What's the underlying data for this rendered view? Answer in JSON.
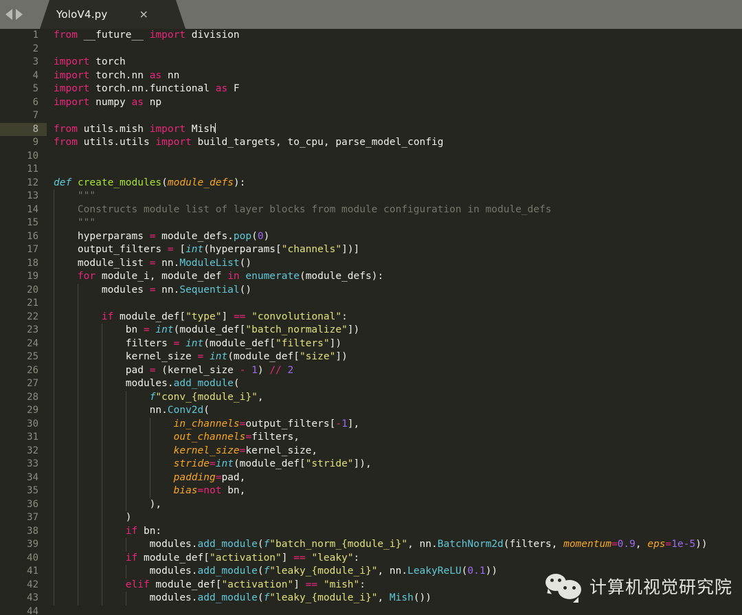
{
  "window": {
    "titlebar_color": "#6f6f69",
    "editor_background": "#262621",
    "nav_back_icon": "triangle-left",
    "nav_forward_icon": "triangle-right"
  },
  "tab": {
    "filename": "YoloV4.py",
    "close_label": "×",
    "active": true
  },
  "editor": {
    "language": "Python",
    "current_line": 8,
    "cursor_line": 8,
    "cursor_column": 30,
    "first_visible_line": 1,
    "last_visible_line": 44,
    "colors": {
      "keyword": "#e9267a",
      "definition": "#5fc9d8",
      "function_name": "#a6e22e",
      "parameter": "#f6a623",
      "string": "#e0e07a",
      "number": "#9d6cf0",
      "builtin": "#5fc9d8",
      "method": "#5fc9d8",
      "comment": "#76766c",
      "plain_text": "#f2f2ec",
      "gutter_text": "#8c8c82",
      "current_line_gutter": "#40402f"
    },
    "lines": [
      {
        "n": 1,
        "indent": 0,
        "tokens": [
          [
            "kw",
            "from"
          ],
          [
            "plain",
            " __future__ "
          ],
          [
            "kw",
            "import"
          ],
          [
            "plain",
            " division"
          ]
        ]
      },
      {
        "n": 2,
        "indent": 0,
        "tokens": []
      },
      {
        "n": 3,
        "indent": 0,
        "tokens": [
          [
            "kw",
            "import"
          ],
          [
            "plain",
            " torch"
          ]
        ]
      },
      {
        "n": 4,
        "indent": 0,
        "tokens": [
          [
            "kw",
            "import"
          ],
          [
            "plain",
            " torch.nn "
          ],
          [
            "kw",
            "as"
          ],
          [
            "plain",
            " nn"
          ]
        ]
      },
      {
        "n": 5,
        "indent": 0,
        "tokens": [
          [
            "kw",
            "import"
          ],
          [
            "plain",
            " torch.nn.functional "
          ],
          [
            "kw",
            "as"
          ],
          [
            "plain",
            " F"
          ]
        ]
      },
      {
        "n": 6,
        "indent": 0,
        "tokens": [
          [
            "kw",
            "import"
          ],
          [
            "plain",
            " numpy "
          ],
          [
            "kw",
            "as"
          ],
          [
            "plain",
            " np"
          ]
        ]
      },
      {
        "n": 7,
        "indent": 0,
        "tokens": []
      },
      {
        "n": 8,
        "indent": 0,
        "current": true,
        "caret_after": true,
        "tokens": [
          [
            "kw",
            "from"
          ],
          [
            "plain",
            " utils.mish "
          ],
          [
            "kw",
            "import"
          ],
          [
            "plain",
            " Mish"
          ]
        ]
      },
      {
        "n": 9,
        "indent": 0,
        "tokens": [
          [
            "kw",
            "from"
          ],
          [
            "plain",
            " utils.utils "
          ],
          [
            "kw",
            "import"
          ],
          [
            "plain",
            " build_targets, to_cpu, parse_model_config"
          ]
        ]
      },
      {
        "n": 10,
        "indent": 0,
        "tokens": []
      },
      {
        "n": 11,
        "indent": 0,
        "tokens": []
      },
      {
        "n": 12,
        "indent": 0,
        "tokens": [
          [
            "def",
            "def"
          ],
          [
            "plain",
            " "
          ],
          [
            "fn",
            "create_modules"
          ],
          [
            "plain",
            "("
          ],
          [
            "param",
            "module_defs"
          ],
          [
            "plain",
            "):"
          ]
        ]
      },
      {
        "n": 13,
        "indent": 1,
        "tokens": [
          [
            "plain",
            "    "
          ],
          [
            "com",
            "\"\"\""
          ]
        ]
      },
      {
        "n": 14,
        "indent": 1,
        "tokens": [
          [
            "plain",
            "    "
          ],
          [
            "com",
            "Constructs module list of layer blocks from module configuration in module_defs"
          ]
        ]
      },
      {
        "n": 15,
        "indent": 1,
        "tokens": [
          [
            "plain",
            "    "
          ],
          [
            "com",
            "\"\"\""
          ]
        ]
      },
      {
        "n": 16,
        "indent": 1,
        "tokens": [
          [
            "plain",
            "    hyperparams "
          ],
          [
            "op",
            "="
          ],
          [
            "plain",
            " module_defs."
          ],
          [
            "meth",
            "pop"
          ],
          [
            "plain",
            "("
          ],
          [
            "num",
            "0"
          ],
          [
            "plain",
            ")"
          ]
        ]
      },
      {
        "n": 17,
        "indent": 1,
        "tokens": [
          [
            "plain",
            "    output_filters "
          ],
          [
            "op",
            "="
          ],
          [
            "plain",
            " ["
          ],
          [
            "builtin",
            "int"
          ],
          [
            "plain",
            "(hyperparams["
          ],
          [
            "str",
            "\"channels\""
          ],
          [
            "plain",
            "])]"
          ]
        ]
      },
      {
        "n": 18,
        "indent": 1,
        "tokens": [
          [
            "plain",
            "    module_list "
          ],
          [
            "op",
            "="
          ],
          [
            "plain",
            " nn."
          ],
          [
            "meth",
            "ModuleList"
          ],
          [
            "plain",
            "()"
          ]
        ]
      },
      {
        "n": 19,
        "indent": 1,
        "tokens": [
          [
            "plain",
            "    "
          ],
          [
            "kw",
            "for"
          ],
          [
            "plain",
            " module_i, module_def "
          ],
          [
            "kw",
            "in"
          ],
          [
            "plain",
            " "
          ],
          [
            "meth",
            "enumerate"
          ],
          [
            "plain",
            "(module_defs):"
          ]
        ]
      },
      {
        "n": 20,
        "indent": 2,
        "tokens": [
          [
            "plain",
            "        modules "
          ],
          [
            "op",
            "="
          ],
          [
            "plain",
            " nn."
          ],
          [
            "meth",
            "Sequential"
          ],
          [
            "plain",
            "()"
          ]
        ]
      },
      {
        "n": 21,
        "indent": 2,
        "tokens": []
      },
      {
        "n": 22,
        "indent": 2,
        "tokens": [
          [
            "plain",
            "        "
          ],
          [
            "kw",
            "if"
          ],
          [
            "plain",
            " module_def["
          ],
          [
            "str",
            "\"type\""
          ],
          [
            "plain",
            "] "
          ],
          [
            "op",
            "=="
          ],
          [
            "plain",
            " "
          ],
          [
            "str",
            "\"convolutional\""
          ],
          [
            "plain",
            ":"
          ]
        ]
      },
      {
        "n": 23,
        "indent": 3,
        "tokens": [
          [
            "plain",
            "            bn "
          ],
          [
            "op",
            "="
          ],
          [
            "plain",
            " "
          ],
          [
            "builtin",
            "int"
          ],
          [
            "plain",
            "(module_def["
          ],
          [
            "str",
            "\"batch_normalize\""
          ],
          [
            "plain",
            "])"
          ]
        ]
      },
      {
        "n": 24,
        "indent": 3,
        "tokens": [
          [
            "plain",
            "            filters "
          ],
          [
            "op",
            "="
          ],
          [
            "plain",
            " "
          ],
          [
            "builtin",
            "int"
          ],
          [
            "plain",
            "(module_def["
          ],
          [
            "str",
            "\"filters\""
          ],
          [
            "plain",
            "])"
          ]
        ]
      },
      {
        "n": 25,
        "indent": 3,
        "tokens": [
          [
            "plain",
            "            kernel_size "
          ],
          [
            "op",
            "="
          ],
          [
            "plain",
            " "
          ],
          [
            "builtin",
            "int"
          ],
          [
            "plain",
            "(module_def["
          ],
          [
            "str",
            "\"size\""
          ],
          [
            "plain",
            "])"
          ]
        ]
      },
      {
        "n": 26,
        "indent": 3,
        "tokens": [
          [
            "plain",
            "            pad "
          ],
          [
            "op",
            "="
          ],
          [
            "plain",
            " (kernel_size "
          ],
          [
            "op",
            "-"
          ],
          [
            "plain",
            " "
          ],
          [
            "num",
            "1"
          ],
          [
            "plain",
            ") "
          ],
          [
            "op",
            "//"
          ],
          [
            "plain",
            " "
          ],
          [
            "num",
            "2"
          ]
        ]
      },
      {
        "n": 27,
        "indent": 3,
        "tokens": [
          [
            "plain",
            "            modules."
          ],
          [
            "meth",
            "add_module"
          ],
          [
            "plain",
            "("
          ]
        ]
      },
      {
        "n": 28,
        "indent": 4,
        "tokens": [
          [
            "plain",
            "                "
          ],
          [
            "builtin",
            "f"
          ],
          [
            "str",
            "\"conv_{module_i}\""
          ],
          [
            "plain",
            ","
          ]
        ]
      },
      {
        "n": 29,
        "indent": 4,
        "tokens": [
          [
            "plain",
            "                nn."
          ],
          [
            "meth",
            "Conv2d"
          ],
          [
            "plain",
            "("
          ]
        ]
      },
      {
        "n": 30,
        "indent": 5,
        "tokens": [
          [
            "plain",
            "                    "
          ],
          [
            "param",
            "in_channels"
          ],
          [
            "op",
            "="
          ],
          [
            "plain",
            "output_filters["
          ],
          [
            "op",
            "-"
          ],
          [
            "num",
            "1"
          ],
          [
            "plain",
            "],"
          ]
        ]
      },
      {
        "n": 31,
        "indent": 5,
        "tokens": [
          [
            "plain",
            "                    "
          ],
          [
            "param",
            "out_channels"
          ],
          [
            "op",
            "="
          ],
          [
            "plain",
            "filters,"
          ]
        ]
      },
      {
        "n": 32,
        "indent": 5,
        "tokens": [
          [
            "plain",
            "                    "
          ],
          [
            "param",
            "kernel_size"
          ],
          [
            "op",
            "="
          ],
          [
            "plain",
            "kernel_size,"
          ]
        ]
      },
      {
        "n": 33,
        "indent": 5,
        "tokens": [
          [
            "plain",
            "                    "
          ],
          [
            "param",
            "stride"
          ],
          [
            "op",
            "="
          ],
          [
            "builtin",
            "int"
          ],
          [
            "plain",
            "(module_def["
          ],
          [
            "str",
            "\"stride\""
          ],
          [
            "plain",
            "]),"
          ]
        ]
      },
      {
        "n": 34,
        "indent": 5,
        "tokens": [
          [
            "plain",
            "                    "
          ],
          [
            "param",
            "padding"
          ],
          [
            "op",
            "="
          ],
          [
            "plain",
            "pad,"
          ]
        ]
      },
      {
        "n": 35,
        "indent": 5,
        "tokens": [
          [
            "plain",
            "                    "
          ],
          [
            "param",
            "bias"
          ],
          [
            "op",
            "="
          ],
          [
            "kw",
            "not"
          ],
          [
            "plain",
            " bn,"
          ]
        ]
      },
      {
        "n": 36,
        "indent": 4,
        "tokens": [
          [
            "plain",
            "                ),"
          ]
        ]
      },
      {
        "n": 37,
        "indent": 3,
        "tokens": [
          [
            "plain",
            "            )"
          ]
        ]
      },
      {
        "n": 38,
        "indent": 3,
        "tokens": [
          [
            "plain",
            "            "
          ],
          [
            "kw",
            "if"
          ],
          [
            "plain",
            " bn:"
          ]
        ]
      },
      {
        "n": 39,
        "indent": 4,
        "tokens": [
          [
            "plain",
            "                modules."
          ],
          [
            "meth",
            "add_module"
          ],
          [
            "plain",
            "("
          ],
          [
            "builtin",
            "f"
          ],
          [
            "str",
            "\"batch_norm_{module_i}\""
          ],
          [
            "plain",
            ", nn."
          ],
          [
            "meth",
            "BatchNorm2d"
          ],
          [
            "plain",
            "(filters, "
          ],
          [
            "param",
            "momentum"
          ],
          [
            "op",
            "="
          ],
          [
            "num",
            "0.9"
          ],
          [
            "plain",
            ", "
          ],
          [
            "param",
            "eps"
          ],
          [
            "op",
            "="
          ],
          [
            "num",
            "1e-5"
          ],
          [
            "plain",
            "))"
          ]
        ]
      },
      {
        "n": 40,
        "indent": 3,
        "tokens": [
          [
            "plain",
            "            "
          ],
          [
            "kw",
            "if"
          ],
          [
            "plain",
            " module_def["
          ],
          [
            "str",
            "\"activation\""
          ],
          [
            "plain",
            "] "
          ],
          [
            "op",
            "=="
          ],
          [
            "plain",
            " "
          ],
          [
            "str",
            "\"leaky\""
          ],
          [
            "plain",
            ":"
          ]
        ]
      },
      {
        "n": 41,
        "indent": 4,
        "tokens": [
          [
            "plain",
            "                modules."
          ],
          [
            "meth",
            "add_module"
          ],
          [
            "plain",
            "("
          ],
          [
            "builtin",
            "f"
          ],
          [
            "str",
            "\"leaky_{module_i}\""
          ],
          [
            "plain",
            ", nn."
          ],
          [
            "meth",
            "LeakyReLU"
          ],
          [
            "plain",
            "("
          ],
          [
            "num",
            "0.1"
          ],
          [
            "plain",
            "))"
          ]
        ]
      },
      {
        "n": 42,
        "indent": 3,
        "tokens": [
          [
            "plain",
            "            "
          ],
          [
            "kw",
            "elif"
          ],
          [
            "plain",
            " module_def["
          ],
          [
            "str",
            "\"activation\""
          ],
          [
            "plain",
            "] "
          ],
          [
            "op",
            "=="
          ],
          [
            "plain",
            " "
          ],
          [
            "str",
            "\"mish\""
          ],
          [
            "plain",
            ":"
          ]
        ]
      },
      {
        "n": 43,
        "indent": 4,
        "tokens": [
          [
            "plain",
            "                modules."
          ],
          [
            "meth",
            "add_module"
          ],
          [
            "plain",
            "("
          ],
          [
            "builtin",
            "f"
          ],
          [
            "str",
            "\"leaky_{module_i}\""
          ],
          [
            "plain",
            ", "
          ],
          [
            "meth",
            "Mish"
          ],
          [
            "plain",
            "())"
          ]
        ]
      },
      {
        "n": 44,
        "indent": 0,
        "tokens": []
      }
    ]
  },
  "watermark": {
    "text": "计算机视觉研究院",
    "logo": "wechat-logo"
  }
}
